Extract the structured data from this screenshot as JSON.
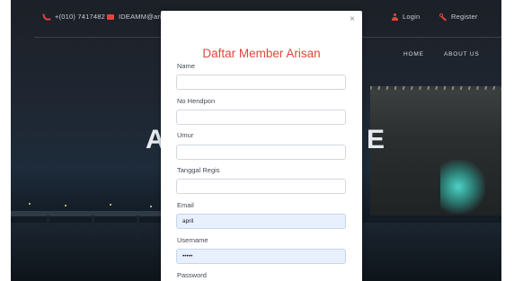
{
  "topbar": {
    "phone": "+(010) 7417482",
    "email": "IDEAMM@ari",
    "login": "Login",
    "register": "Register"
  },
  "nav": {
    "home": "HOME",
    "about": "ABOUT US"
  },
  "hero": {
    "left_letter": "A",
    "right_letter": "E"
  },
  "modal": {
    "close": "×",
    "title": "Daftar Member Arisan",
    "fields": [
      {
        "label": "Name",
        "value": ""
      },
      {
        "label": "No Hendpon",
        "value": ""
      },
      {
        "label": "Umur",
        "value": ""
      },
      {
        "label": "Tanggal Regis",
        "value": ""
      },
      {
        "label": "Email",
        "value": "april"
      },
      {
        "label": "Username",
        "value": "•••••"
      },
      {
        "label": "Password",
        "value": ""
      }
    ]
  },
  "colors": {
    "accent": "#e2453c",
    "autofill": "#e8f0fe"
  },
  "icons": [
    "phone-icon",
    "mail-icon",
    "user-icon",
    "key-icon",
    "close-icon"
  ]
}
